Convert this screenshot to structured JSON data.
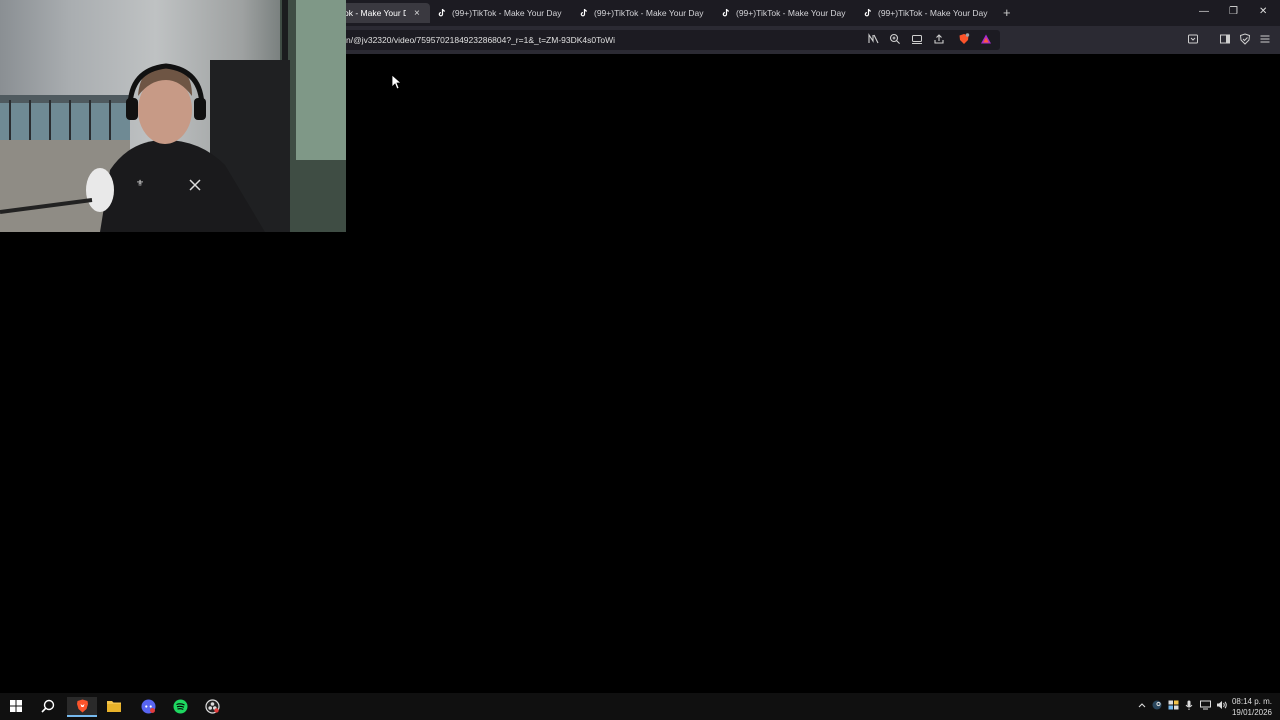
{
  "browser": {
    "tabs": [
      {
        "title": "ok - Make Your D",
        "active": true,
        "close": "×"
      },
      {
        "title": "(99+)TikTok - Make Your Day",
        "active": false
      },
      {
        "title": "(99+)TikTok - Make Your Day",
        "active": false
      },
      {
        "title": "(99+)TikTok - Make Your Day",
        "active": false
      },
      {
        "title": "(99+)TikTok - Make Your Day",
        "active": false
      }
    ],
    "new_tab": "+",
    "window_controls": {
      "minimize": "—",
      "restore": "❐",
      "close": "✕"
    },
    "url": "n/@jv32320/video/7595702184923286804?_r=1&_t=ZM-93DK4s0ToWi",
    "toolbar_icons": [
      "no-autoplay-icon",
      "zoom-icon",
      "cast-icon",
      "share-icon",
      "brave-shields-icon",
      "brave-rewards-icon",
      "reader-icon",
      "sidebar-icon",
      "wallet-icon",
      "menu-icon"
    ]
  },
  "taskbar": {
    "icons": [
      "windows-start-icon",
      "search-icon",
      "brave-icon",
      "file-explorer-icon",
      "discord-icon",
      "spotify-icon",
      "obs-icon"
    ],
    "tray_icons": [
      "chevron-up-icon",
      "steam-icon",
      "network-icon",
      "mic-icon",
      "usb-icon",
      "volume-icon"
    ],
    "time": "08:14 p. m.",
    "date": "19/01/2026"
  },
  "colors": {
    "tabbar": "#1c1b22",
    "toolbar": "#2b2a33",
    "taskbar": "#101010",
    "page": "#000000"
  }
}
